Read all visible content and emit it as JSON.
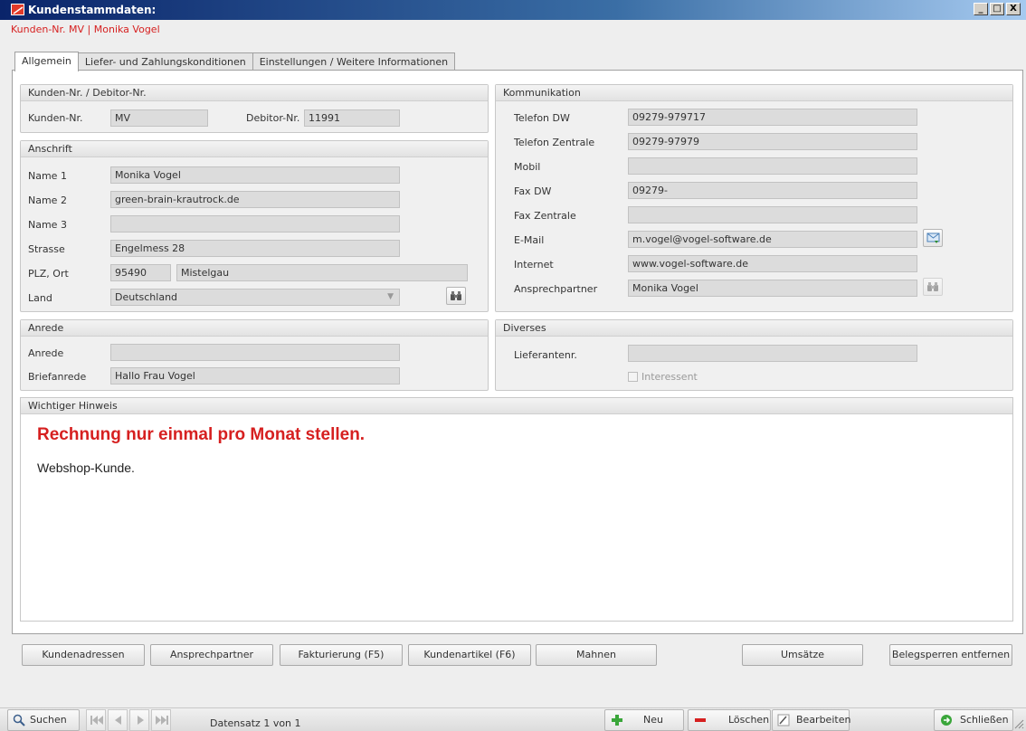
{
  "window": {
    "title": "Kundenstammdaten:",
    "subtitle": "Kunden-Nr. MV | Monika Vogel",
    "controls": [
      "_",
      "□",
      "X"
    ]
  },
  "tabs": [
    {
      "label": "Allgemein",
      "active": true
    },
    {
      "label": "Liefer- und Zahlungskonditionen",
      "active": false
    },
    {
      "label": "Einstellungen / Weitere Informationen",
      "active": false
    }
  ],
  "kundennr_group": {
    "title": "Kunden-Nr. / Debitor-Nr.",
    "kundennr_label": "Kunden-Nr.",
    "kundennr_value": "MV",
    "debitornr_label": "Debitor-Nr.",
    "debitornr_value": "11991"
  },
  "anschrift": {
    "title": "Anschrift",
    "name1_label": "Name 1",
    "name1_value": "Monika Vogel",
    "name2_label": "Name 2",
    "name2_value": "green-brain-krautrock.de",
    "name3_label": "Name 3",
    "name3_value": "",
    "strasse_label": "Strasse",
    "strasse_value": "Engelmess 28",
    "plzort_label": "PLZ, Ort",
    "plz_value": "95490",
    "ort_value": "Mistelgau",
    "land_label": "Land",
    "land_value": "Deutschland"
  },
  "anrede": {
    "title": "Anrede",
    "anrede_label": "Anrede",
    "anrede_value": "",
    "briefanrede_label": "Briefanrede",
    "briefanrede_value": "Hallo Frau Vogel"
  },
  "kommunikation": {
    "title": "Kommunikation",
    "telefon_dw_label": "Telefon DW",
    "telefon_dw_value": "09279-979717",
    "telefon_zentrale_label": "Telefon Zentrale",
    "telefon_zentrale_value": "09279-97979",
    "mobil_label": "Mobil",
    "mobil_value": "",
    "fax_dw_label": "Fax DW",
    "fax_dw_value": "09279-",
    "fax_zentrale_label": "Fax Zentrale",
    "fax_zentrale_value": "",
    "email_label": "E-Mail",
    "email_value": "m.vogel@vogel-software.de",
    "internet_label": "Internet",
    "internet_value": "www.vogel-software.de",
    "ansprechpartner_label": "Ansprechpartner",
    "ansprechpartner_value": "Monika Vogel"
  },
  "diverses": {
    "title": "Diverses",
    "lieferantennr_label": "Lieferantenr.",
    "lieferantennr_value": "",
    "interessent_label": "Interessent",
    "interessent_checked": false
  },
  "hinweis": {
    "title": "Wichtiger Hinweis",
    "line1": "Rechnung nur einmal pro Monat stellen.",
    "line2": "Webshop-Kunde.",
    "line1_color": "#d62020"
  },
  "action_buttons": {
    "kundenadressen": "Kundenadressen",
    "ansprechpartner": "Ansprechpartner",
    "fakturierung": "Fakturierung  (F5)",
    "kundenartikel": "Kundenartikel (F6)",
    "mahnen": "Mahnen",
    "umsaetze": "Umsätze",
    "belegsperren": "Belegsperren entfernen"
  },
  "statusbar": {
    "suchen": "Suchen",
    "datensatz": "Datensatz 1 von 1",
    "neu": "Neu",
    "loeschen": "Löschen",
    "bearbeiten": "Bearbeiten",
    "schliessen": "Schließen"
  },
  "icons": {
    "app": "app-icon",
    "binoculars": "binoculars-icon",
    "email_send": "email-send-icon",
    "search": "search-icon",
    "nav_first": "first-record-icon",
    "nav_prev": "previous-record-icon",
    "nav_next": "next-record-icon",
    "nav_last": "last-record-icon",
    "add": "plus-icon",
    "delete": "minus-icon",
    "edit": "pencil-icon",
    "close": "exit-icon"
  },
  "colors": {
    "accent_red": "#d62020",
    "titlebar_start": "#0a246a",
    "titlebar_end": "#a6caf0",
    "field_bg": "#dcdcdc"
  }
}
